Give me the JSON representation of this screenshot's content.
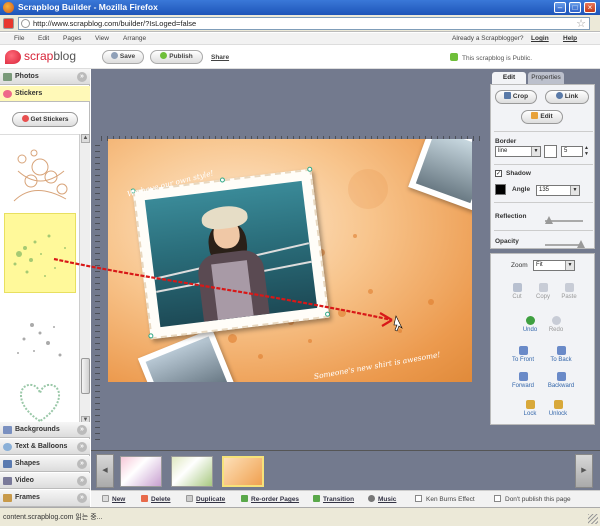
{
  "browser": {
    "title": "Scrapblog Builder - Mozilla Firefox",
    "url": "http://www.scrapblog.com/builder/?IsLoged=false",
    "status": "content.scrapblog.com 읽는 중..."
  },
  "menu": {
    "items": [
      "File",
      "Edit",
      "Pages",
      "View",
      "Arrange"
    ],
    "already": "Already a Scrapblogger?",
    "login": "Login",
    "help": "Help"
  },
  "toolbar": {
    "logo_prefix": "scrap",
    "logo_suffix": "blog",
    "save": "Save",
    "publish": "Publish",
    "share": "Share",
    "public_status": "This scrapblog is Public."
  },
  "left_panel": {
    "photos": "Photos",
    "stickers": "Stickers",
    "get_stickers": "Get Stickers",
    "backgrounds": "Backgrounds",
    "text_balloons": "Text & Balloons",
    "shapes": "Shapes",
    "video": "Video",
    "frames": "Frames"
  },
  "canvas": {
    "caption_top": "We have our own style!",
    "caption_bottom": "Someone's new shirt is awesome!"
  },
  "right_panel": {
    "tab_edit": "Edit",
    "tab_properties": "Properties",
    "crop": "Crop",
    "link": "Link",
    "edit": "Edit",
    "border_label": "Border",
    "border_value": "line",
    "border_size": "5",
    "shadow_label": "Shadow",
    "shadow_checked": true,
    "angle_label": "Angle",
    "angle_value": "135",
    "reflection_label": "Reflection",
    "opacity_label": "Opacity",
    "zoom_label": "Zoom",
    "zoom_value": "Fit",
    "cut": "Cut",
    "copy": "Copy",
    "paste": "Paste",
    "undo": "Undo",
    "redo": "Redo",
    "to_front": "To Front",
    "to_back": "To Back",
    "forward": "Forward",
    "backward": "Backward",
    "lock": "Lock",
    "unlock": "Unlock"
  },
  "bottom_bar": {
    "new": "New",
    "delete": "Delete",
    "duplicate": "Duplicate",
    "reorder": "Re-order Pages",
    "transition": "Transition",
    "music": "Music",
    "ken_burns": "Ken Burns Effect",
    "dont_publish": "Don't publish this page"
  },
  "colors": {
    "stage": "#737a8e",
    "accent": "#d82438",
    "selected_sticker": "#fff99a",
    "canvas_orange": "#ec9a4e"
  }
}
